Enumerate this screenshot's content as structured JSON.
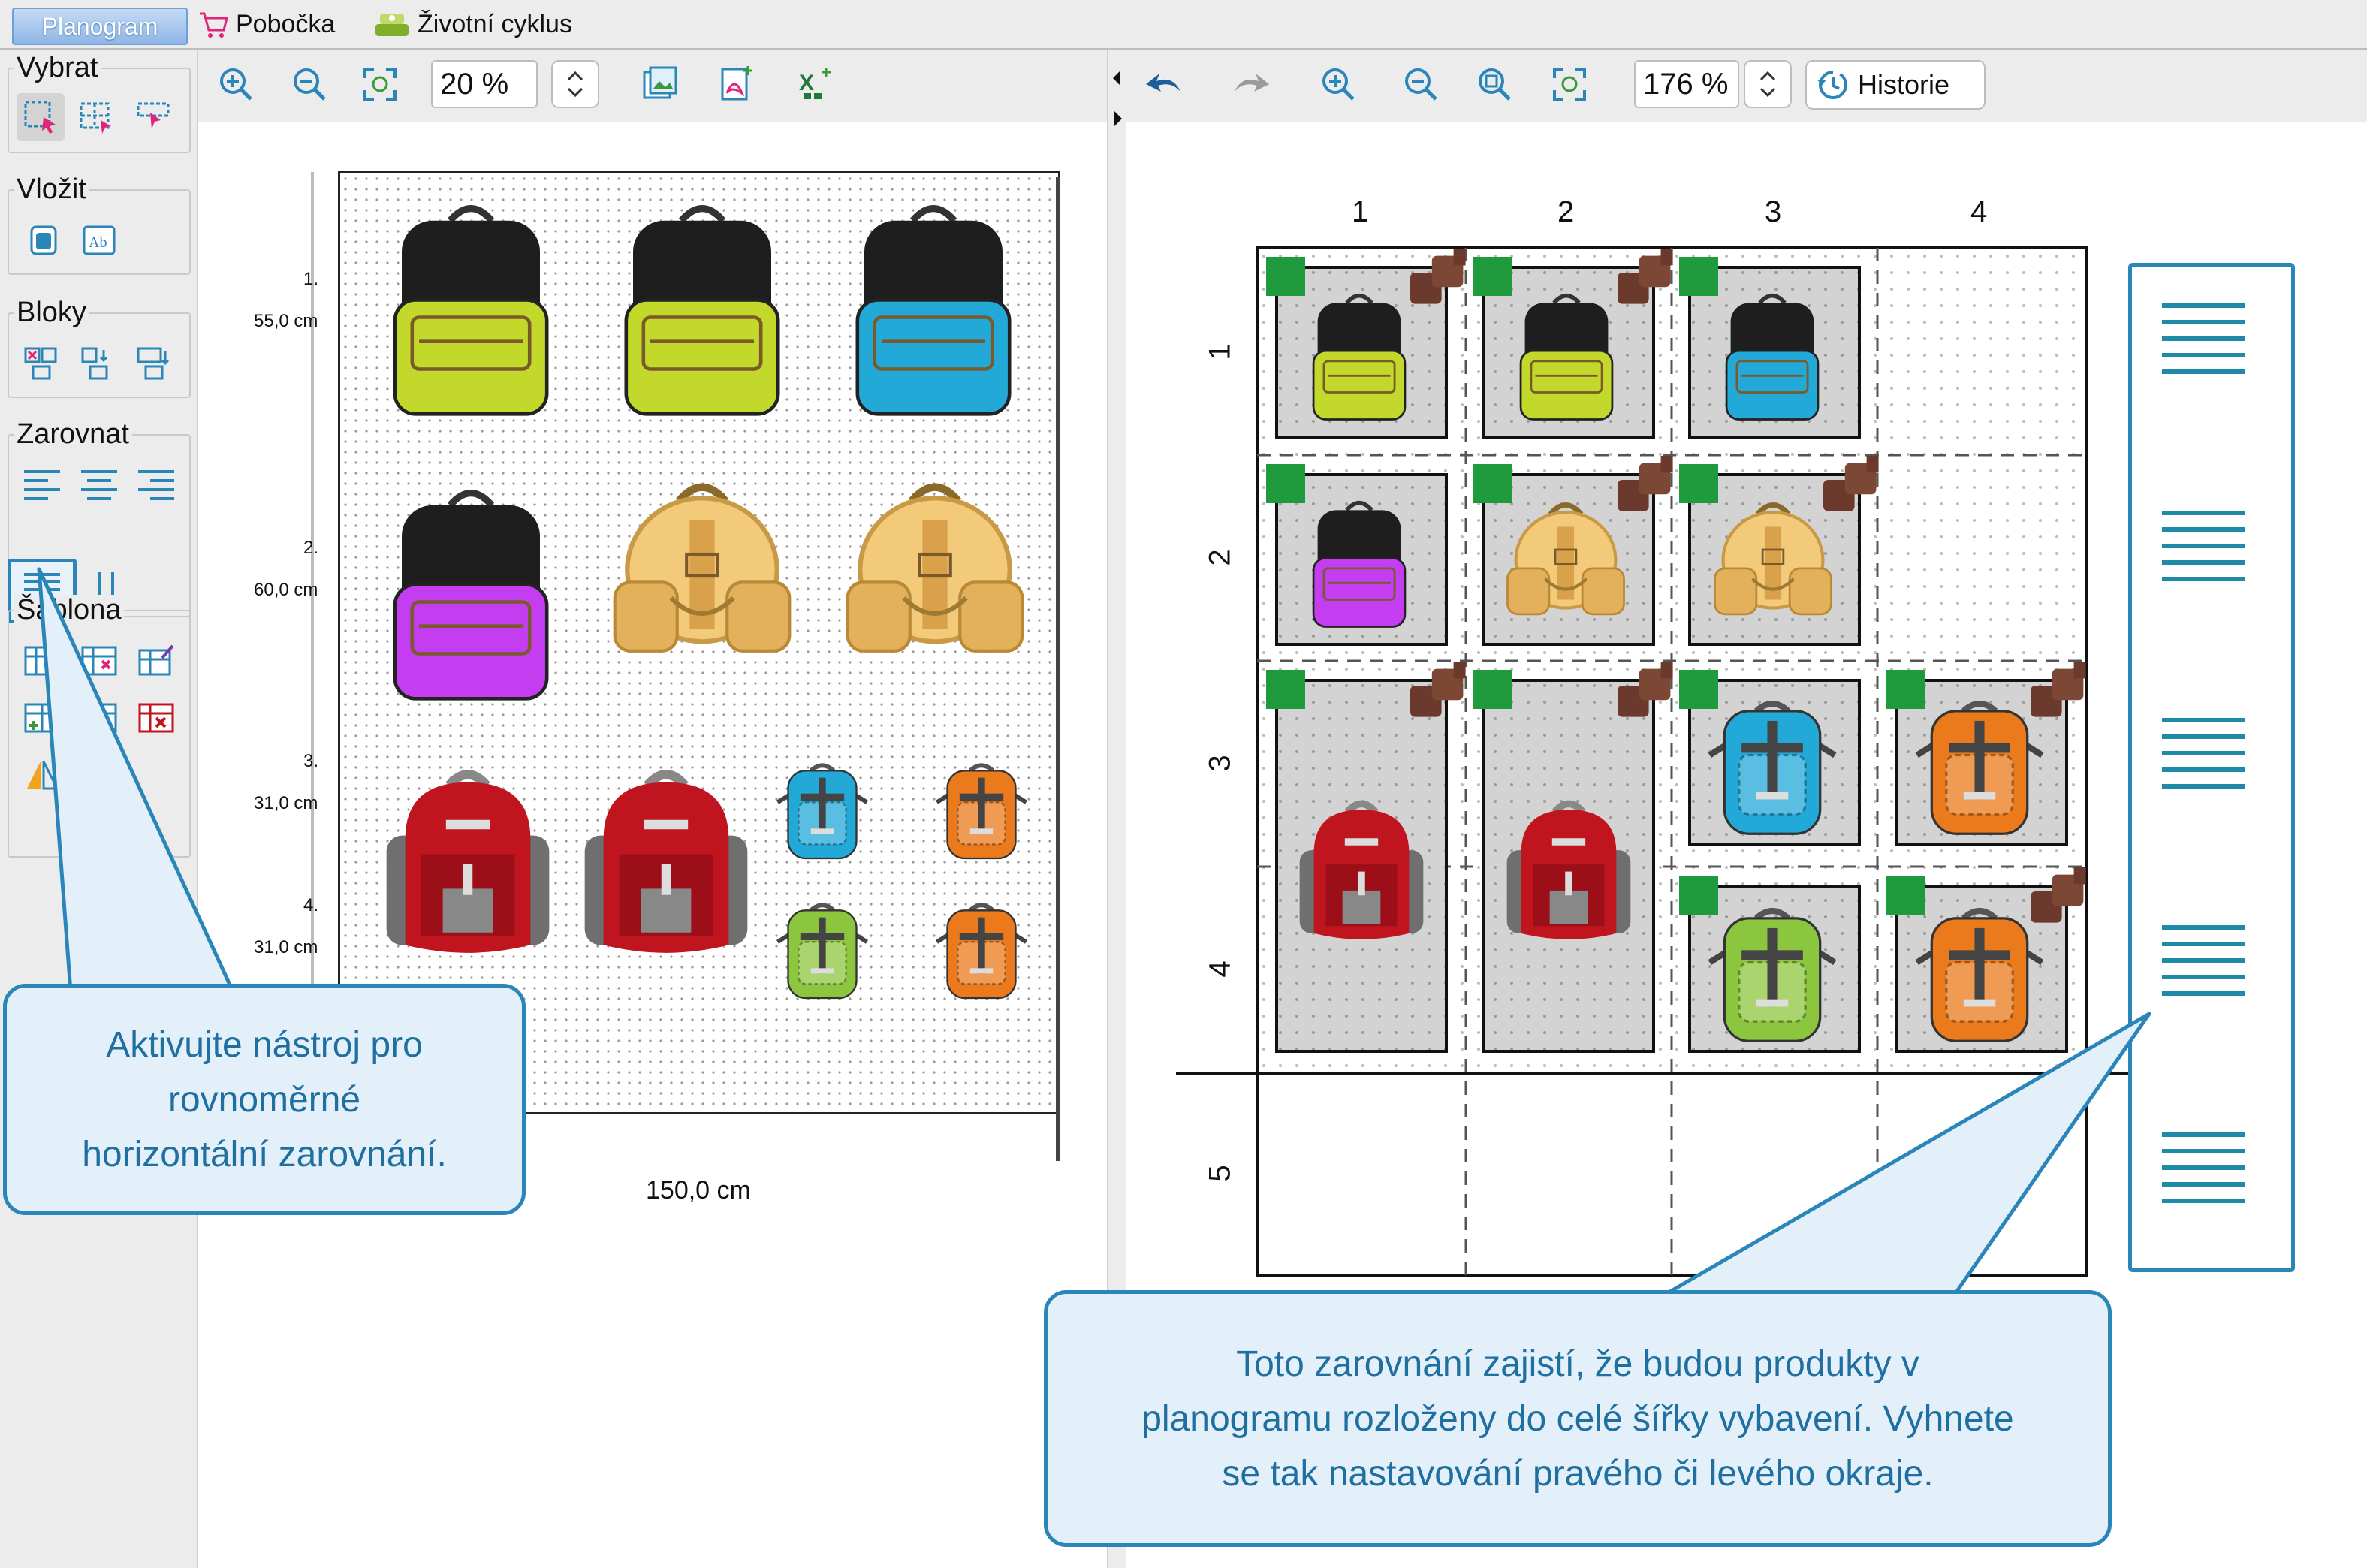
{
  "tabs": [
    {
      "label": "Planogram",
      "active": true
    },
    {
      "label": "Pobočka",
      "icon": "cart-icon"
    },
    {
      "label": "Životní cyklus",
      "icon": "lifecycle-icon"
    }
  ],
  "tool_groups": {
    "select": {
      "title": "Vybrat"
    },
    "insert": {
      "title": "Vložit"
    },
    "blocks": {
      "title": "Bloky"
    },
    "align": {
      "title": "Zarovnat"
    },
    "template": {
      "title": "Šablona"
    }
  },
  "left_toolbar": {
    "zoom": "20 %"
  },
  "right_toolbar": {
    "zoom": "176 %",
    "history_label": "Historie"
  },
  "fixture": {
    "width_label": "150,0 cm",
    "shelves": [
      {
        "index": "1.",
        "height": "55,0 cm"
      },
      {
        "index": "2.",
        "height": "60,0 cm"
      },
      {
        "index": "3.",
        "height": "31,0 cm"
      },
      {
        "index": "4.",
        "height": "31,0 cm"
      }
    ]
  },
  "grid": {
    "columns": [
      "1",
      "2",
      "3",
      "4"
    ],
    "rows": [
      "1",
      "2",
      "3",
      "4",
      "5"
    ]
  },
  "callouts": {
    "left": {
      "lines": [
        "Aktivujte nástroj pro",
        "rovnoměrné",
        "horizontální zarovnání."
      ]
    },
    "right": {
      "lines": [
        "Toto zarovnání zajistí, že budou produkty v",
        "planogramu rozloženy do celé šířky vybavení. Vyhnete",
        "se tak nastavování pravého či levého okraje."
      ]
    }
  },
  "colors": {
    "accent": "#2a86b8",
    "callout_bg": "#e3f0fa",
    "bag_lime": "#c2d82a",
    "bag_blue": "#23a9d8",
    "bag_purple": "#c43df0",
    "bag_beige": "#f3c97a",
    "bag_red": "#c0141f",
    "bag_orange": "#ea7a1b",
    "bag_green": "#8cc63e",
    "marker_green": "#1f9a3c",
    "marker_brown": "#6b3a2c"
  }
}
